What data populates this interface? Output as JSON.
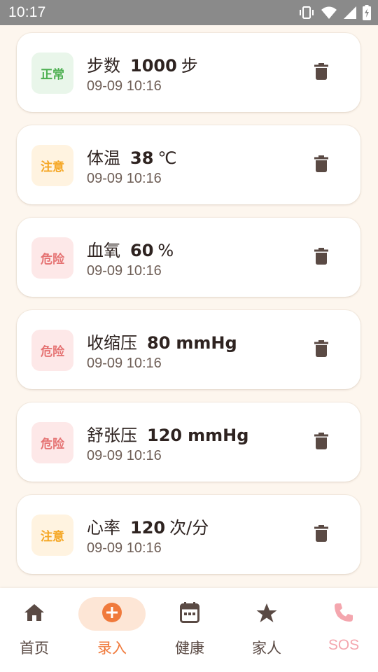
{
  "status_bar": {
    "time": "10:17",
    "icons": [
      "vibrate-icon",
      "wifi-icon",
      "signal-icon",
      "battery-charging-icon"
    ]
  },
  "records": [
    {
      "badge": "正常",
      "level": "normal",
      "name": "步数",
      "value": "1000",
      "unit": "步",
      "time": "09-09 10:16"
    },
    {
      "badge": "注意",
      "level": "warn",
      "name": "体温",
      "value": "38",
      "unit": "℃",
      "time": "09-09 10:16"
    },
    {
      "badge": "危险",
      "level": "danger",
      "name": "血氧",
      "value": "60",
      "unit": "%",
      "time": "09-09 10:16"
    },
    {
      "badge": "危险",
      "level": "danger",
      "name": "收缩压",
      "value": "80",
      "unit": "mmHg",
      "time": "09-09 10:16"
    },
    {
      "badge": "危险",
      "level": "danger",
      "name": "舒张压",
      "value": "120",
      "unit": "mmHg",
      "time": "09-09 10:16"
    },
    {
      "badge": "注意",
      "level": "warn",
      "name": "心率",
      "value": "120",
      "unit": "次/分",
      "time": "09-09 10:16"
    }
  ],
  "nav": [
    {
      "label": "首页",
      "icon": "home-icon",
      "active": false
    },
    {
      "label": "录入",
      "icon": "add-circle-icon",
      "active": true
    },
    {
      "label": "健康",
      "icon": "calendar-icon",
      "active": false
    },
    {
      "label": "家人",
      "icon": "star-icon",
      "active": false
    },
    {
      "label": "SOS",
      "icon": "phone-icon",
      "active": false
    }
  ],
  "colors": {
    "background": "#FDF6EE",
    "status_bar": "#8A8A8A",
    "normal": "#4CAF50",
    "warn": "#F5A623",
    "danger": "#E57373",
    "accent": "#F07A3C",
    "sos": "#F4A6AE",
    "icon_brown": "#5A4A44"
  }
}
